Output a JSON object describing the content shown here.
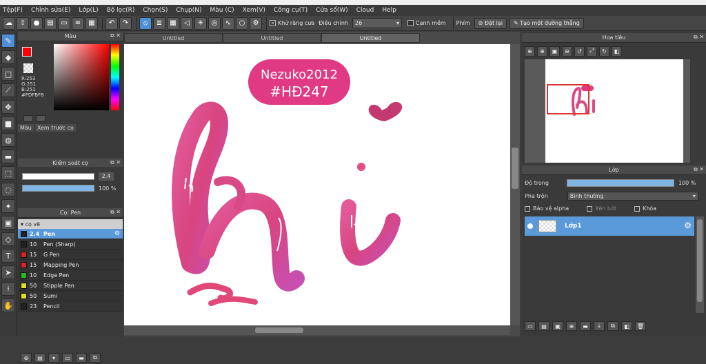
{
  "menu": [
    "Tệp(F)",
    "Chỉnh sửa(E)",
    "Lớp(L)",
    "Bộ lọc(R)",
    "Chọn(S)",
    "Chụp(N)",
    "Màu (C)",
    "Xem(V)",
    "Công cụ(T)",
    "Cửa sổ(W)",
    "Cloud",
    "Help"
  ],
  "toolbar": {
    "antialias_label": "Khử răng cưa",
    "adjust_label": "Điều chỉnh",
    "adjust_value": "26",
    "smooth_label": "Cạnh mềm",
    "key_label": "Phím",
    "reset_label": "Đặt lại",
    "line_label": "Tạo một đường thẳng"
  },
  "color_panel": {
    "title": "Màu",
    "rgb": [
      "R:253",
      "G:251",
      "B:251"
    ],
    "hex": "#FDFBF8",
    "tabs": [
      "Màu",
      "Xem trước cọ"
    ],
    "fg": "#ff0000"
  },
  "brush_control": {
    "title": "Kiểm soát cọ",
    "size_value": "2.4",
    "size_fraction": 0.97,
    "opacity_value": "100 %"
  },
  "brush_panel": {
    "title": "Cọ: Pen",
    "group": "cọ vẽ",
    "items": [
      {
        "size": "2.4",
        "name": "Pen",
        "color": "#222222",
        "selected": true
      },
      {
        "size": "10",
        "name": "Pen (Sharp)",
        "color": "#222222",
        "selected": false
      },
      {
        "size": "15",
        "name": "G Pen",
        "color": "#e02020",
        "selected": false
      },
      {
        "size": "15",
        "name": "Mapping Pen",
        "color": "#e02020",
        "selected": false
      },
      {
        "size": "10",
        "name": "Edge Pen",
        "color": "#20c020",
        "selected": false
      },
      {
        "size": "50",
        "name": "Stipple Pen",
        "color": "#e0e020",
        "selected": false
      },
      {
        "size": "50",
        "name": "Sumi",
        "color": "#e0e020",
        "selected": false
      },
      {
        "size": "23",
        "name": "Pencil",
        "color": "#222222",
        "selected": false
      }
    ]
  },
  "tabs": [
    "Untitled",
    "Untitled",
    "Untitled"
  ],
  "canvas_text": {
    "bubble_line1": "Nezuko2012",
    "bubble_line2": "#HĐ247",
    "hi": "hi"
  },
  "navigator": {
    "title": "Hoa tiêu"
  },
  "layer_panel": {
    "title": "Lớp",
    "opacity_label": "Độ trong",
    "opacity_value": "100 %",
    "blend_label": "Pha trộn",
    "blend_value": "Bình thường",
    "protect_alpha": "Bảo vệ alpha",
    "clip": "Xén bớt",
    "lock": "Khóa",
    "layer_name": "Lớp1"
  }
}
